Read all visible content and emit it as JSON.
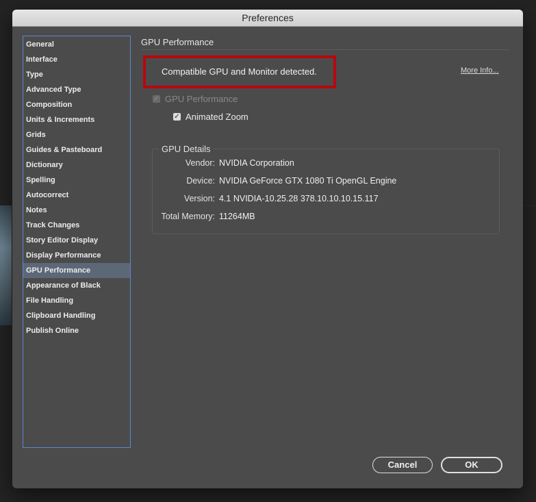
{
  "window": {
    "title": "Preferences"
  },
  "sidebar": {
    "items": [
      {
        "label": "General"
      },
      {
        "label": "Interface"
      },
      {
        "label": "Type"
      },
      {
        "label": "Advanced Type"
      },
      {
        "label": "Composition"
      },
      {
        "label": "Units & Increments"
      },
      {
        "label": "Grids"
      },
      {
        "label": "Guides & Pasteboard"
      },
      {
        "label": "Dictionary"
      },
      {
        "label": "Spelling"
      },
      {
        "label": "Autocorrect"
      },
      {
        "label": "Notes"
      },
      {
        "label": "Track Changes"
      },
      {
        "label": "Story Editor Display"
      },
      {
        "label": "Display Performance"
      },
      {
        "label": "GPU Performance"
      },
      {
        "label": "Appearance of Black"
      },
      {
        "label": "File Handling"
      },
      {
        "label": "Clipboard Handling"
      },
      {
        "label": "Publish Online"
      }
    ],
    "selected": "GPU Performance"
  },
  "main": {
    "section_title": "GPU Performance",
    "status_message": "Compatible GPU and Monitor detected.",
    "more_info_link": "More Info...",
    "gpu_performance_checkbox": {
      "label": "GPU Performance",
      "checked": true,
      "enabled": false
    },
    "animated_zoom_checkbox": {
      "label": "Animated Zoom",
      "checked": true,
      "enabled": true
    },
    "gpu_details": {
      "title": "GPU Details",
      "vendor_label": "Vendor:",
      "vendor_value": "NVIDIA Corporation",
      "device_label": "Device:",
      "device_value": "NVIDIA GeForce GTX 1080 Ti OpenGL Engine",
      "version_label": "Version:",
      "version_value": "4.1 NVIDIA-10.25.28 378.10.10.10.15.117",
      "memory_label": "Total Memory:",
      "memory_value": "11264MB"
    }
  },
  "buttons": {
    "cancel_label": "Cancel",
    "ok_label": "OK"
  },
  "colors": {
    "dialog_background": "#4b4b4b",
    "selection": "#5c6778",
    "sidebar_border": "#5b88d4",
    "highlight_box": "#b8070d"
  },
  "icons": {
    "checkmark": "check-icon"
  }
}
